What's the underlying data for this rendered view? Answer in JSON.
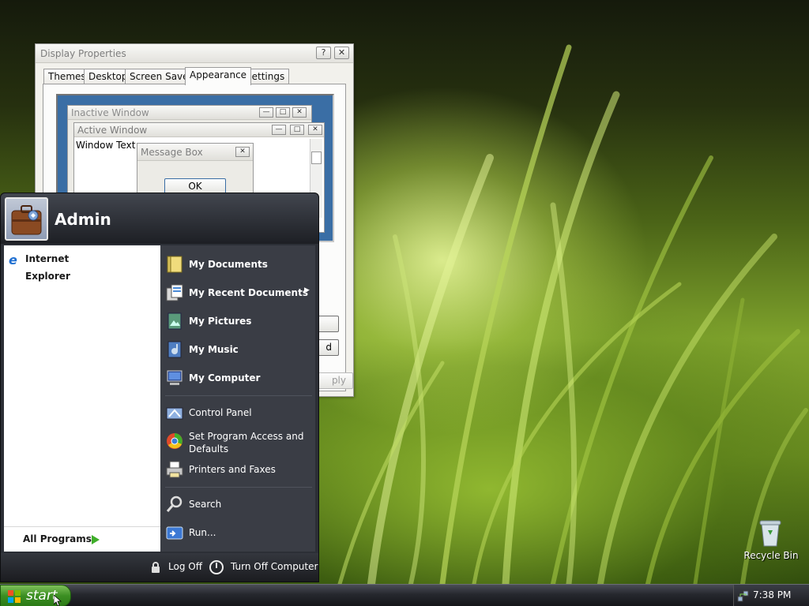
{
  "display_properties": {
    "title": "Display Properties",
    "help_button": "?",
    "close_button": "✕",
    "tabs": [
      {
        "label": "Themes"
      },
      {
        "label": "Desktop"
      },
      {
        "label": "Screen Saver"
      },
      {
        "label": "Appearance"
      },
      {
        "label": "Settings"
      }
    ],
    "preview": {
      "inactive_title": "Inactive Window",
      "active_title": "Active Window",
      "window_text": "Window Text",
      "message_box_title": "Message Box",
      "ok_label": "OK"
    },
    "partial_button_labels": [
      "d",
      "ply"
    ]
  },
  "start_menu": {
    "username": "Admin",
    "pinned": [
      {
        "label": "Internet Explorer",
        "icon": "ie-icon"
      }
    ],
    "all_programs": "All Programs",
    "right_items": [
      {
        "label": "My Documents",
        "icon": "documents-icon"
      },
      {
        "label": "My Recent Documents",
        "icon": "recent-docs-icon"
      },
      {
        "label": "My Pictures",
        "icon": "pictures-icon"
      },
      {
        "label": "My Music",
        "icon": "music-icon"
      },
      {
        "label": "My Computer",
        "icon": "computer-icon"
      },
      {
        "label": "Control Panel",
        "icon": "control-panel-icon"
      },
      {
        "label": "Set Program Access and Defaults",
        "icon": "program-defaults-icon"
      },
      {
        "label": "Printers and Faxes",
        "icon": "printer-icon"
      },
      {
        "label": "Search",
        "icon": "search-icon"
      },
      {
        "label": "Run...",
        "icon": "run-icon"
      }
    ],
    "log_off": "Log Off",
    "turn_off": "Turn Off Computer"
  },
  "taskbar": {
    "start_label": "start",
    "clock": "7:38 PM"
  },
  "desktop": {
    "recycle_bin": "Recycle Bin"
  }
}
